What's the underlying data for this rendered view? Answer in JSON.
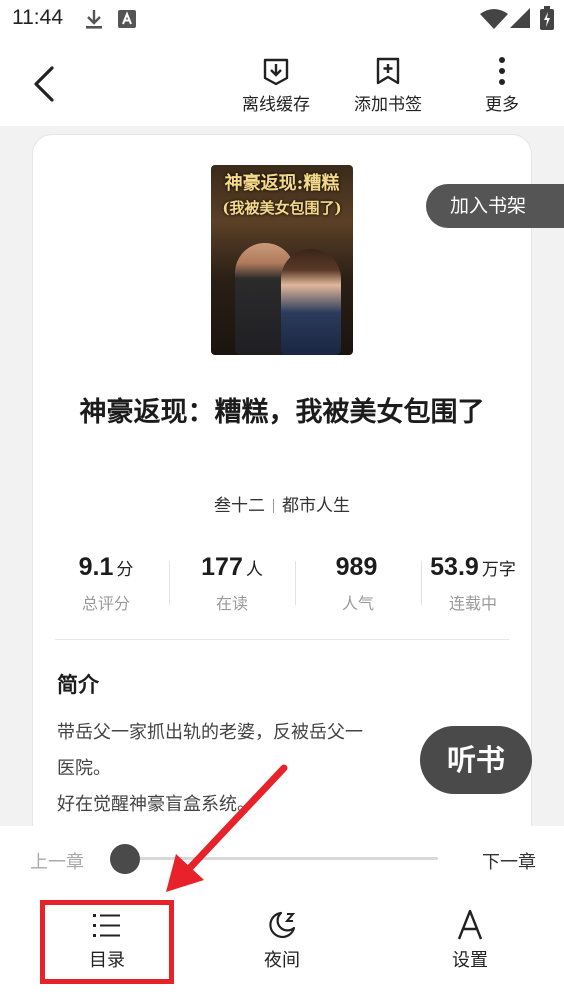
{
  "status_bar": {
    "time": "11:44",
    "icons": [
      "download-icon",
      "font-a-icon",
      "wifi-icon",
      "signal-icon",
      "battery-icon"
    ]
  },
  "toolbar": {
    "back_icon": "chevron-left-icon",
    "actions": [
      {
        "icon": "offline-download-icon",
        "label": "离线缓存"
      },
      {
        "icon": "add-bookmark-icon",
        "label": "添加书签"
      },
      {
        "icon": "more-vertical-icon",
        "label": "更多"
      }
    ]
  },
  "book": {
    "cover_title_line1": "神豪返现:糟糕",
    "cover_title_line2": "(我被美女包围了)",
    "title": "神豪返现：糟糕，我被美女包围了",
    "author": "叁十二",
    "category": "都市人生",
    "stats": [
      {
        "value": "9.1",
        "unit": "分",
        "label": "总评分"
      },
      {
        "value": "177",
        "unit": "人",
        "label": "在读"
      },
      {
        "value": "989",
        "unit": "",
        "label": "人气"
      },
      {
        "value": "53.9",
        "unit": "万字",
        "label": "连载中"
      }
    ],
    "intro_heading": "简介",
    "intro_line1": "带岳父一家抓出轨的老婆，反被岳父一",
    "intro_line2": "医院。",
    "intro_line3": "好在觉醒神豪盲盒系统。"
  },
  "shelf_button": "加入书架",
  "listen_button": "听书",
  "reader_bar": {
    "prev_chapter": "上一章",
    "next_chapter": "下一章",
    "progress_fraction": 0.0
  },
  "bottom_nav": [
    {
      "icon": "table-of-contents-icon",
      "label": "目录"
    },
    {
      "icon": "night-mode-icon",
      "label": "夜间"
    },
    {
      "icon": "settings-font-icon",
      "label": "设置"
    }
  ],
  "annotation": {
    "color": "#e8222a"
  }
}
